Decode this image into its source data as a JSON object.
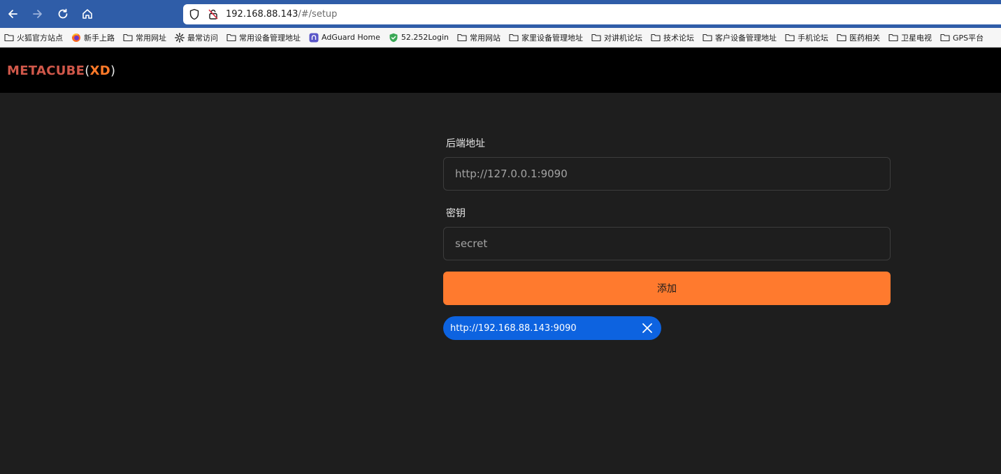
{
  "browser": {
    "url_host": "192.168.88.143",
    "url_path": "/#/setup",
    "nav_icons": [
      "back-arrow-icon",
      "forward-arrow-icon",
      "reload-icon",
      "home-icon"
    ]
  },
  "bookmarks": [
    {
      "label": "火狐官方站点",
      "icon": "folder-icon"
    },
    {
      "label": "新手上路",
      "icon": "firefox-icon"
    },
    {
      "label": "常用网址",
      "icon": "folder-icon"
    },
    {
      "label": "最常访问",
      "icon": "gear-icon"
    },
    {
      "label": "常用设备管理地址",
      "icon": "folder-icon"
    },
    {
      "label": "AdGuard Home",
      "icon": "adguard-icon"
    },
    {
      "label": "52.252Login",
      "icon": "shield-check-icon"
    },
    {
      "label": "常用网站",
      "icon": "folder-icon"
    },
    {
      "label": "家里设备管理地址",
      "icon": "folder-icon"
    },
    {
      "label": "对讲机论坛",
      "icon": "folder-icon"
    },
    {
      "label": "技术论坛",
      "icon": "folder-icon"
    },
    {
      "label": "客户设备管理地址",
      "icon": "folder-icon"
    },
    {
      "label": "手机论坛",
      "icon": "folder-icon"
    },
    {
      "label": "医药相关",
      "icon": "folder-icon"
    },
    {
      "label": "卫星电视",
      "icon": "folder-icon"
    },
    {
      "label": "GPS平台",
      "icon": "folder-icon"
    }
  ],
  "app": {
    "logo_main": "METACUBE",
    "logo_open": "(",
    "logo_xd": "XD",
    "logo_close": ")"
  },
  "form": {
    "backend_label": "后端地址",
    "backend_placeholder": "http://127.0.0.1:9090",
    "secret_label": "密钥",
    "secret_placeholder": "secret",
    "add_button": "添加"
  },
  "saved_backends": [
    {
      "url": "http://192.168.88.143:9090"
    }
  ],
  "colors": {
    "accent": "#ff7a2e",
    "chip": "#0d63e0",
    "background": "#1e1e1e",
    "header": "#000000"
  }
}
